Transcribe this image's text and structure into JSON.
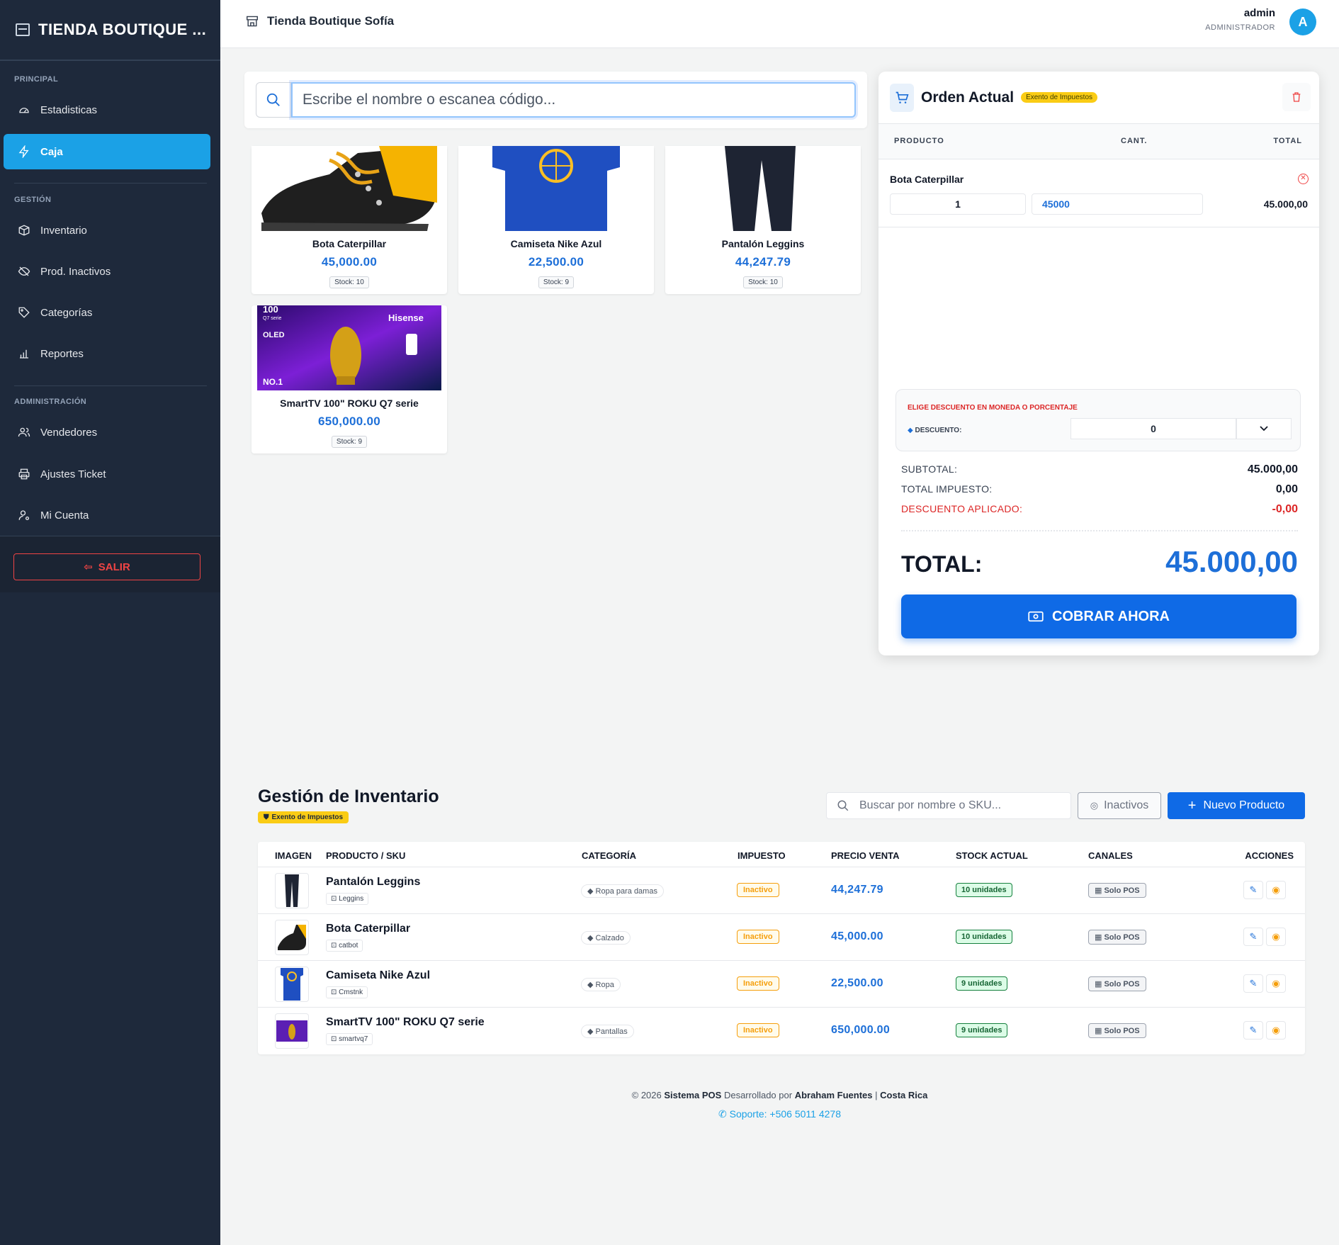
{
  "sidebar": {
    "brand": "TIENDA BOUTIQUE ...",
    "sections": {
      "principal": "PRINCIPAL",
      "gestion": "GESTIÓN",
      "admin": "ADMINISTRACIÓN"
    },
    "items": {
      "estadisticas": "Estadisticas",
      "caja": "Caja",
      "inventario": "Inventario",
      "inactivos": "Prod. Inactivos",
      "categorias": "Categorías",
      "reportes": "Reportes",
      "vendedores": "Vendedores",
      "ticket": "Ajustes Ticket",
      "cuenta": "Mi Cuenta"
    },
    "logout": "SALIR"
  },
  "topbar": {
    "store": "Tienda Boutique Sofía",
    "user": "admin",
    "role": "ADMINISTRADOR",
    "avatar": "A"
  },
  "search": {
    "placeholder": "Escribe el nombre o escanea código..."
  },
  "products": [
    {
      "name": "Bota Caterpillar",
      "price": "45,000.00",
      "stock": "Stock: 10"
    },
    {
      "name": "Camiseta Nike Azul",
      "price": "22,500.00",
      "stock": "Stock: 9"
    },
    {
      "name": "Pantalón Leggins",
      "price": "44,247.79",
      "stock": "Stock: 10"
    },
    {
      "name": "SmartTV 100\" ROKU Q7 serie",
      "price": "650,000.00",
      "stock": "Stock: 9",
      "img_text": {
        "size": "100",
        "serie": "Q7 serie",
        "brand": "Hisense",
        "tech": "OLED",
        "no": "NO.1"
      }
    }
  ],
  "order": {
    "title": "Orden Actual",
    "badge": "Exento de Impuestos",
    "headers": {
      "product": "PRODUCTO",
      "qty": "CANT.",
      "total": "TOTAL"
    },
    "item": {
      "name": "Bota Caterpillar",
      "qty": "1",
      "price": "45000",
      "total": "45.000,00"
    },
    "discount_title": "ELIGE DESCUENTO EN MONEDA O PORCENTAJE",
    "discount_label": "DESCUENTO:",
    "discount_value": "0",
    "subtotal_label": "SUBTOTAL:",
    "subtotal": "45.000,00",
    "tax_label": "TOTAL IMPUESTO:",
    "tax": "0,00",
    "disc_applied_label": "DESCUENTO APLICADO:",
    "disc_applied": "-0,00",
    "total_label": "TOTAL:",
    "total": "45.000,00",
    "charge": "COBRAR AHORA"
  },
  "inventory": {
    "title": "Gestión de Inventario",
    "badge": "Exento de Impuestos",
    "search_placeholder": "Buscar por nombre o SKU...",
    "inactive_btn": "Inactivos",
    "new_btn": "Nuevo Producto",
    "headers": {
      "image": "IMAGEN",
      "product": "PRODUCTO / SKU",
      "category": "CATEGORÍA",
      "tax": "IMPUESTO",
      "price": "PRECIO VENTA",
      "stock": "STOCK ACTUAL",
      "channels": "CANALES",
      "actions": "ACCIONES"
    },
    "rows": [
      {
        "name": "Pantalón Leggins",
        "sku": "Leggins",
        "category": "Ropa para damas",
        "tax": "Inactivo",
        "price": "44,247.79",
        "stock": "10 unidades",
        "channel": "Solo POS"
      },
      {
        "name": "Bota Caterpillar",
        "sku": "catbot",
        "category": "Calzado",
        "tax": "Inactivo",
        "price": "45,000.00",
        "stock": "10 unidades",
        "channel": "Solo POS"
      },
      {
        "name": "Camiseta Nike Azul",
        "sku": "Cmstnk",
        "category": "Ropa",
        "tax": "Inactivo",
        "price": "22,500.00",
        "stock": "9 unidades",
        "channel": "Solo POS"
      },
      {
        "name": "SmartTV 100\" ROKU Q7 serie",
        "sku": "smartvq7",
        "category": "Pantallas",
        "tax": "Inactivo",
        "price": "650,000.00",
        "stock": "9 unidades",
        "channel": "Solo POS"
      }
    ]
  },
  "footer": {
    "copy": "© 2026",
    "system": "Sistema POS",
    "dev": "Desarrollado por",
    "author": "Abraham Fuentes",
    "sep": "|",
    "country": "Costa Rica",
    "support": "Soporte: +506 5011 4278"
  }
}
